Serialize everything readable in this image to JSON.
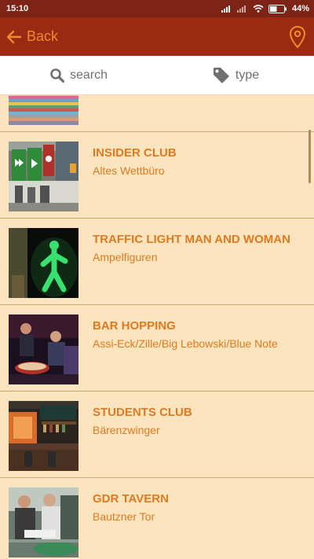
{
  "status_bar": {
    "time": "15:10",
    "battery": "44%"
  },
  "header": {
    "back_label": "Back",
    "icons": [
      "arrow-left-icon",
      "location-pin-icon"
    ]
  },
  "filters": [
    {
      "label": "search",
      "icon": "search-icon"
    },
    {
      "label": "type",
      "icon": "tag-icon"
    }
  ],
  "list": {
    "items": [
      {
        "title": "INSIDER CLUB",
        "subtitle": "Altes Wettbüro"
      },
      {
        "title": "TRAFFIC LIGHT MAN AND WOMAN",
        "subtitle": "Ampelfiguren"
      },
      {
        "title": "BAR HOPPING",
        "subtitle": "Assi-Eck/Zille/Big Lebowski/Blue Note"
      },
      {
        "title": "STUDENTS CLUB",
        "subtitle": "Bärenzwinger"
      },
      {
        "title": "GDR TAVERN",
        "subtitle": "Bautzner Tor"
      }
    ]
  },
  "colors": {
    "status_bar": "#7d2416",
    "app_bar": "#9c2a12",
    "accent": "#f08a2a",
    "list_background": "#fbe4be",
    "item_text": "#e07a20",
    "divider": "#d9a36a"
  }
}
